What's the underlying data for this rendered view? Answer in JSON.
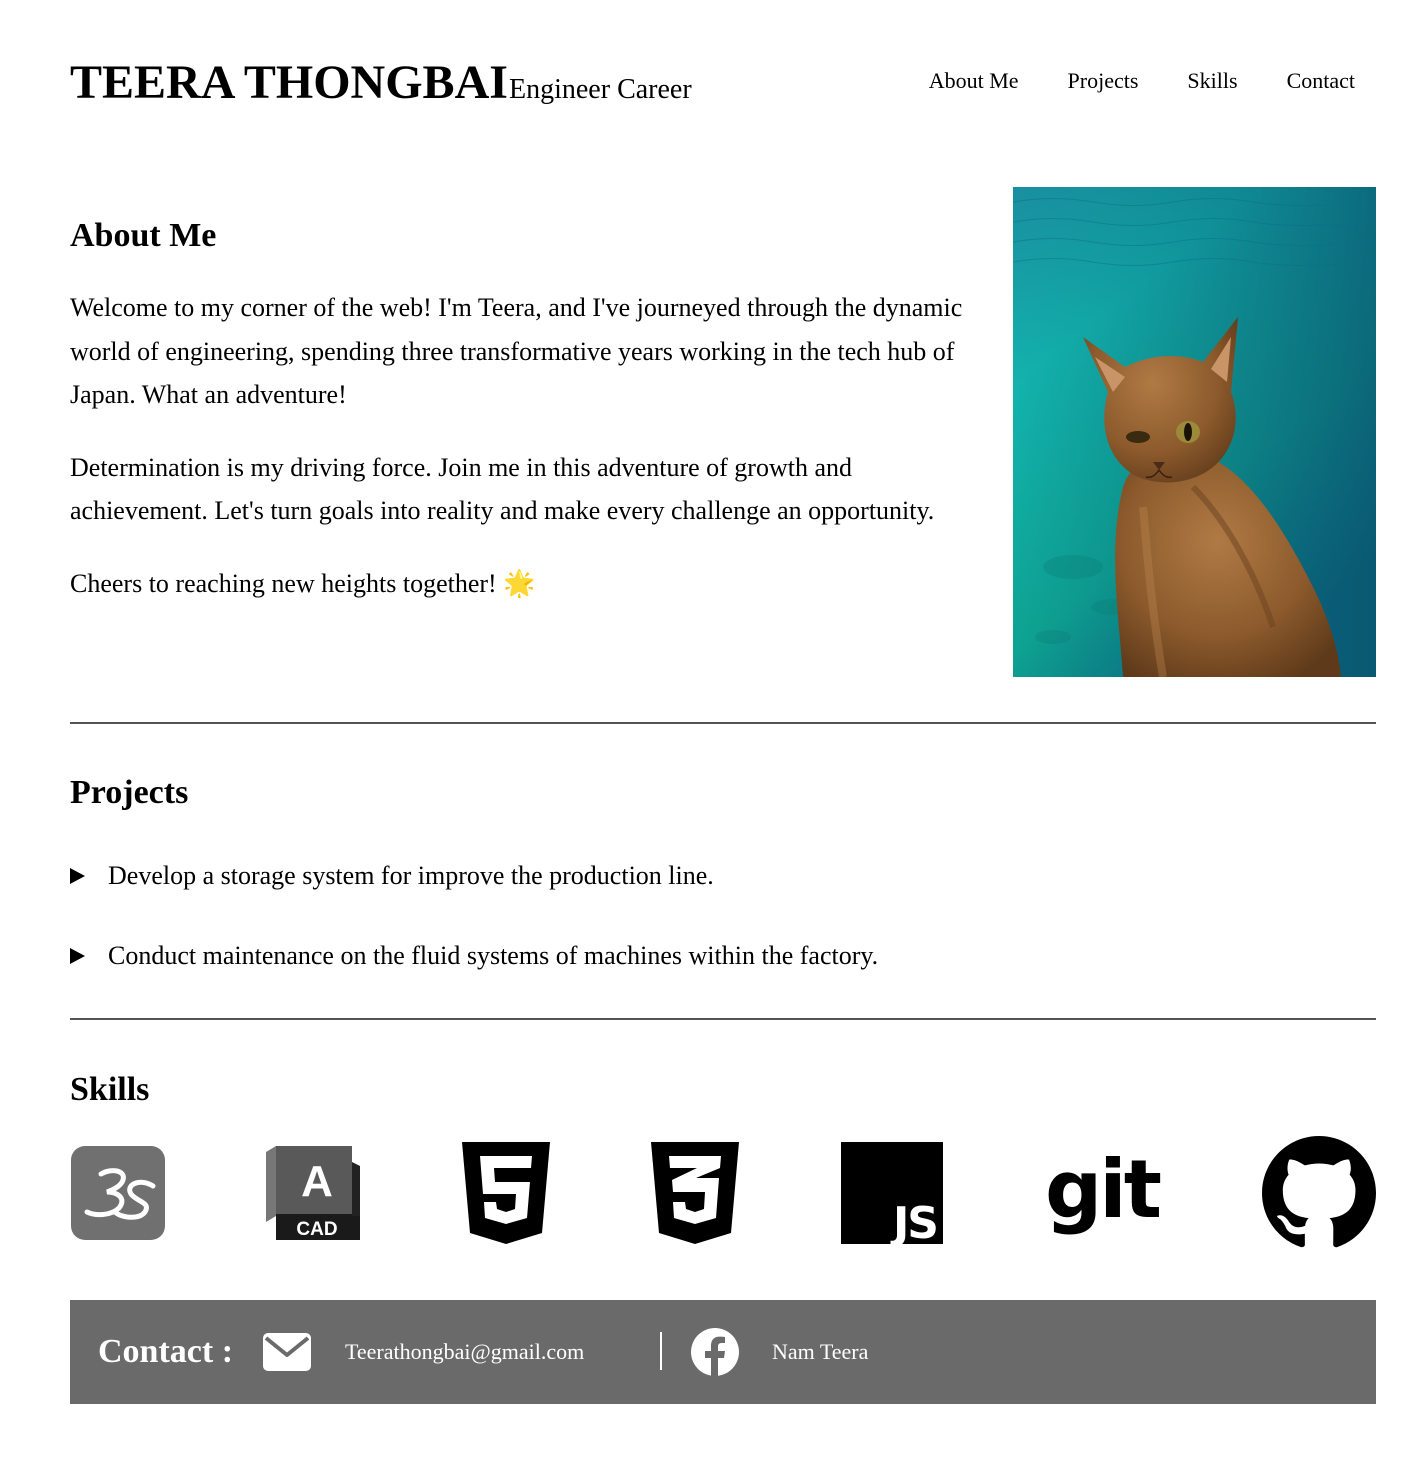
{
  "header": {
    "name": "TEERA THONGBAI",
    "subtitle": "Engineer Career",
    "nav": [
      "About Me",
      "Projects",
      "Skills",
      "Contact"
    ]
  },
  "about": {
    "title": "About Me",
    "paragraphs": [
      "Welcome to my corner of the web! I'm Teera, and I've journeyed through the dynamic world of engineering, spending three transformative years working in the tech hub of Japan. What an adventure!",
      "Determination is my driving force. Join me in this adventure of growth and achievement. Let's turn goals into reality and make every challenge an opportunity.",
      "Cheers to reaching new heights together! 🌟"
    ],
    "photo_icon": "cat-photo"
  },
  "projects": {
    "title": "Projects",
    "items": [
      "Develop a storage system for improve the production line.",
      "Conduct maintenance on the fluid systems of machines within the factory."
    ]
  },
  "skills": {
    "title": "Skills",
    "icons": [
      "3ds-max-icon",
      "autocad-icon",
      "html5-icon",
      "css3-icon",
      "javascript-icon",
      "git-icon",
      "github-icon"
    ],
    "autocad_letter": "A",
    "autocad_text": "CAD",
    "js_text": "JS",
    "git_text": "git"
  },
  "contact": {
    "label": "Contact :",
    "email": "Teerathongbai@gmail.com",
    "facebook": "Nam Teera",
    "bar_color": "#6a6a6a"
  }
}
